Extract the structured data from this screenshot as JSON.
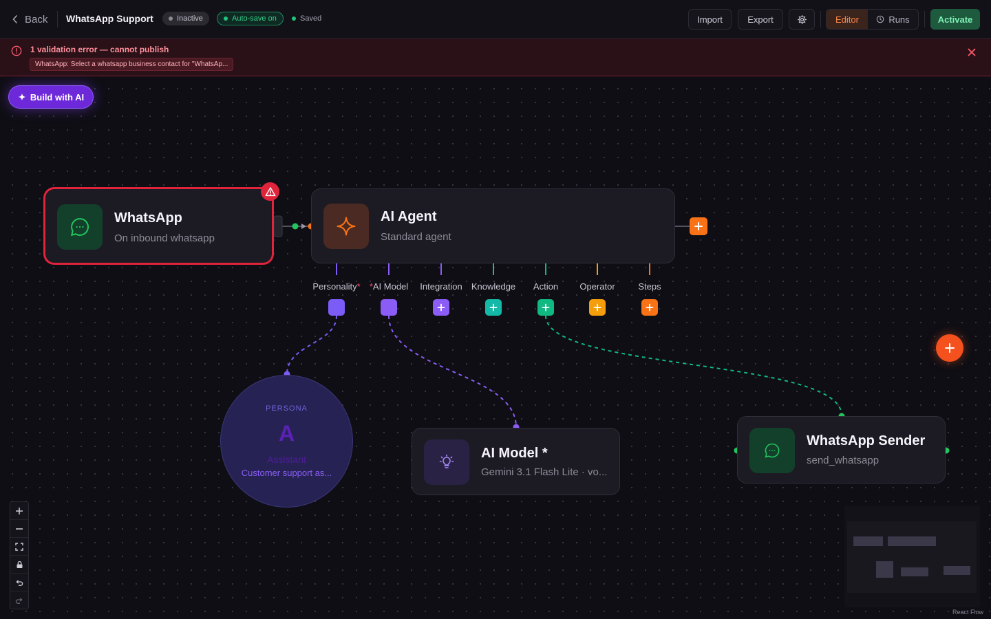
{
  "header": {
    "back_label": "Back",
    "title": "WhatsApp Support",
    "status_badge": "Inactive",
    "autosave_badge": "Auto-save on",
    "saved_label": "Saved",
    "import_label": "Import",
    "export_label": "Export",
    "settings_icon": "gear-icon",
    "editor_tab": "Editor",
    "runs_tab": "Runs",
    "activate_label": "Activate"
  },
  "error_banner": {
    "title": "1 validation error — cannot publish",
    "detail": "WhatsApp: Select a whatsapp business contact for \"WhatsAp...",
    "icon": "alert-circle-icon"
  },
  "canvas": {
    "build_ai_label": "Build with AI",
    "nodes": {
      "whatsapp_trigger": {
        "title": "WhatsApp",
        "subtitle": "On inbound whatsapp"
      },
      "ai_agent": {
        "title": "AI Agent",
        "subtitle": "Standard agent"
      },
      "ai_model": {
        "title": "AI Model *",
        "subtitle": "Gemini 3.1 Flash Lite · vo..."
      },
      "whatsapp_sender": {
        "title": "WhatsApp Sender",
        "subtitle": "send_whatsapp"
      },
      "persona": {
        "tag": "PERSONA",
        "avatar": "A",
        "name": "Assistant",
        "description": "Customer support as..."
      }
    },
    "slots": [
      {
        "label": "Personality",
        "required": "*",
        "color": "#7c5cf6",
        "filled": true
      },
      {
        "label": "AI Model",
        "required": "*",
        "color": "#8b5cf6",
        "filled": true
      },
      {
        "label": "Integration",
        "required": "",
        "color": "#8b5cf6",
        "filled": false
      },
      {
        "label": "Knowledge",
        "required": "",
        "color": "#14b8a6",
        "filled": false
      },
      {
        "label": "Action",
        "required": "",
        "color": "#10b981",
        "filled": false
      },
      {
        "label": "Operator",
        "required": "",
        "color": "#f59e0b",
        "filled": false
      },
      {
        "label": "Steps",
        "required": "",
        "color": "#f97316",
        "filled": false
      }
    ],
    "attribution": "React Flow"
  },
  "colors": {
    "error": "#e0243c",
    "accent_orange": "#f97316",
    "whatsapp_green": "#22c55e",
    "purple": "#7c3aed"
  }
}
